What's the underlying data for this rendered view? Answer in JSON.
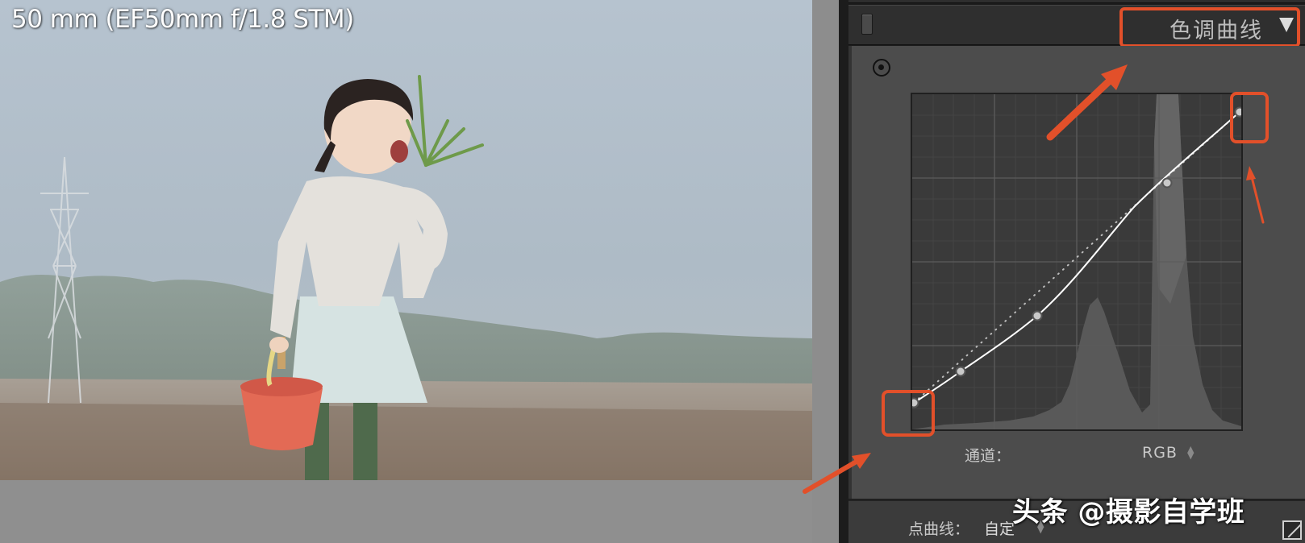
{
  "photo": {
    "lens_info": "50 mm (EF50mm f/1.8 STM)"
  },
  "panel": {
    "title": "色调曲线",
    "collapse_icon": "triangle-down-icon",
    "target_icon": "targeted-adjustment-icon",
    "channel_label": "通道：",
    "channel_value": "RGB",
    "point_curve_label": "点曲线：",
    "point_curve_value": "自定",
    "corner_icon": "linear-curve-icon"
  },
  "watermark": "头条 @摄影自学班",
  "colors": {
    "highlight": "#e2502a",
    "panel_bg": "#4c4c4c",
    "curve": "#ffffff"
  }
}
